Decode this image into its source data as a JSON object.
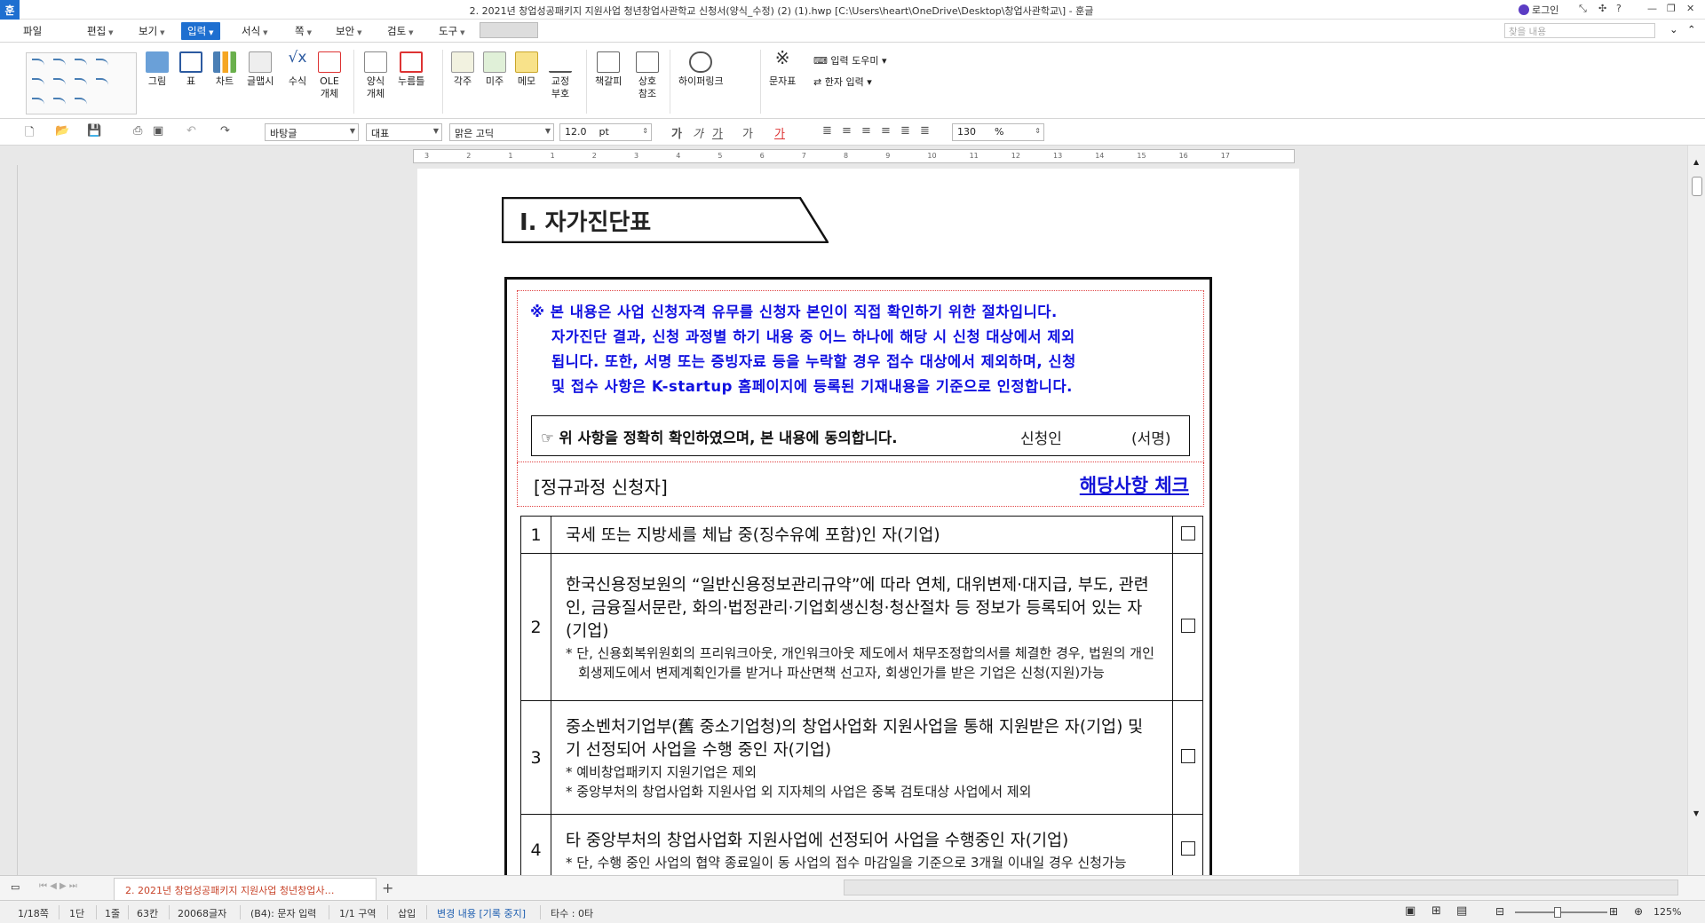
{
  "titlebar": {
    "app_glyph": "훈",
    "title": "2. 2021년 창업성공패키지 지원사업 청년창업사관학교 신청서(양식_수정) (2) (1).hwp [C:\\Users\\heart\\OneDrive\\Desktop\\창업사관학교\\] - 훈글",
    "login": "로그인"
  },
  "menu": {
    "file": "파일",
    "edit": "편집",
    "view": "보기",
    "insert": "입력",
    "format": "서식",
    "page": "쪽",
    "security": "보안",
    "review": "검토",
    "tools": "도구",
    "search_placeholder": "찾을 내용"
  },
  "ribbon": {
    "picture": "그림",
    "table": "표",
    "chart": "차트",
    "wordart": "글맵시",
    "equation": "수식",
    "ole": "OLE 개체",
    "form": "양식 개체",
    "pushpin": "누름틀",
    "footnote": "각주",
    "endnote": "미주",
    "memo": "메모",
    "proof": "교정 부호",
    "bookmark": "책갈피",
    "crossref": "상호 참조",
    "hyperlink": "하이퍼링크",
    "charmap": "문자표",
    "input_helper": "입력 도우미",
    "hanja": "한자 입력"
  },
  "toolbar2": {
    "style": "바탕글",
    "lang": "대표",
    "font": "맑은 고딕",
    "size": "12.0",
    "unit": "pt",
    "zoom": "130",
    "zoom_unit": "%"
  },
  "ruler_numbers": [
    "3",
    "2",
    "1",
    "1",
    "2",
    "3",
    "4",
    "5",
    "6",
    "7",
    "8",
    "9",
    "10",
    "11",
    "12",
    "13",
    "14",
    "15",
    "16",
    "17"
  ],
  "document": {
    "section_title": "Ⅰ. 자가진단표",
    "notice_lines": [
      "※ 본 내용은 사업 신청자격 유무를 신청자 본인이 직접 확인하기 위한 절차입니다.",
      "자가진단 결과, 신청 과정별 하기 내용 중 어느 하나에 해당 시 신청 대상에서 제외",
      "됩니다. 또한, 서명 또는 증빙자료 등을 누락할 경우 접수 대상에서 제외하며, 신청",
      "및 접수 사항은 K-startup 홈페이지에 등록된 기재내용을 기준으로 인정합니다."
    ],
    "consent": "☞ 위 사항을 정확히 확인하였으며, 본 내용에 동의합니다.",
    "applicant": "신청인",
    "signature": "(서명)",
    "section_label": "[정규과정 신청자]",
    "check_label": "해당사항 체크",
    "rows": [
      {
        "num": "1",
        "main": "국세 또는 지방세를 체납 중(징수유예 포함)인 자(기업)",
        "subs": []
      },
      {
        "num": "2",
        "main": "한국신용정보원의 “일반신용정보관리규약”에 따라 연체, 대위변제·대지급, 부도, 관련인, 금융질서문란, 화의·법정관리·기업회생신청·청산절차 등 정보가 등록되어 있는 자(기업)",
        "subs": [
          "* 단, 신용회복위원회의 프리워크아웃, 개인워크아웃 제도에서 채무조정합의서를 체결한 경우, 법원의 개인회생제도에서 변제계획인가를 받거나 파산면책 선고자, 회생인가를 받은 기업은 신청(지원)가능"
        ]
      },
      {
        "num": "3",
        "main": "중소벤처기업부(舊 중소기업청)의 창업사업화 지원사업을 통해 지원받은 자(기업) 및 기 선정되어 사업을 수행 중인 자(기업)",
        "subs": [
          "* 예비창업패키지 지원기업은 제외",
          "* 중앙부처의 창업사업화 지원사업 외 지자체의 사업은 중복 검토대상 사업에서 제외"
        ]
      },
      {
        "num": "4",
        "main": "타 중앙부처의 창업사업화 지원사업에 선정되어 사업을 수행중인 자(기업)",
        "subs": [
          "* 단, 수행 중인 사업의 협약 종료일이 동 사업의 접수 마감일을 기준으로 3개월 이내일 경우 신청가능"
        ]
      }
    ]
  },
  "tabs": {
    "doc_tab": "2. 2021년 창업성공패키지 지원사업 청년창업사…"
  },
  "status": {
    "page": "1/18쪽",
    "column": "1단",
    "line": "1줄",
    "col": "63칸",
    "chars": "20068글자",
    "mode": "(B4): 문자 입력",
    "section": "1/1 구역",
    "insert": "삽입",
    "track": "변경 내용 [기록 중지]",
    "typing": "타수 : 0타",
    "zoom": "125%"
  }
}
